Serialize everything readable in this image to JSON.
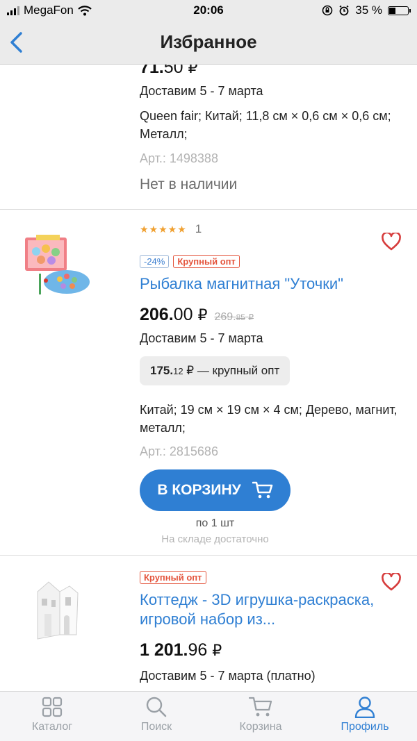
{
  "status_bar": {
    "carrier": "MegaFon",
    "time": "20:06",
    "battery": "35 %"
  },
  "nav": {
    "title": "Избранное"
  },
  "items": [
    {
      "price_main": "71.",
      "price_kop": "50",
      "currency": "₽",
      "delivery": "Доставим 5 - 7 марта",
      "specs": "Queen fair; Китай; 11,8 см × 0,6 см × 0,6 см; Металл;",
      "sku": "Арт.: 1498388",
      "availability": "Нет в наличии"
    },
    {
      "stars": "★★★★★",
      "reviews": "1",
      "discount_badge": "-24%",
      "opt_badge": "Крупный опт",
      "name": "Рыбалка магнитная \"Уточки\"",
      "price_main": "206.",
      "price_kop": "00",
      "currency": "₽",
      "old_price_main": "269.",
      "old_price_kop": "85",
      "old_currency": "₽",
      "delivery": "Доставим 5 - 7 марта",
      "wholesale_price_main": "175.",
      "wholesale_price_kop": "12",
      "wholesale_text": "₽ — крупный опт",
      "specs": "Китай; 19 см × 19 см × 4 см; Дерево, магнит, металл;",
      "sku": "Арт.: 2815686",
      "button_label": "В КОРЗИНУ",
      "qty": "по 1 шт",
      "stock": "На складе достаточно"
    },
    {
      "opt_badge": "Крупный опт",
      "name": "Коттедж  - 3D игрушка-раскраска, игровой набор из...",
      "price_main": "1 201.",
      "price_kop": "96",
      "currency": "₽",
      "delivery": "Доставим 5 - 7 марта (платно)"
    }
  ],
  "tabs": [
    {
      "label": "Каталог",
      "icon": "grid-icon"
    },
    {
      "label": "Поиск",
      "icon": "search-icon"
    },
    {
      "label": "Корзина",
      "icon": "cart-icon"
    },
    {
      "label": "Профиль",
      "icon": "profile-icon"
    }
  ],
  "colors": {
    "accent": "#2f7fd3",
    "badge_red": "#e4553d",
    "star": "#f0a030"
  }
}
